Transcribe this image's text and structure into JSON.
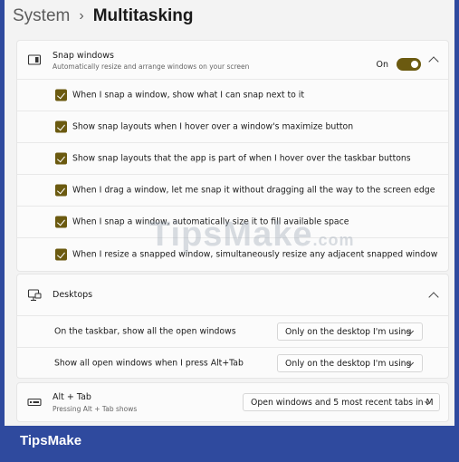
{
  "header": {
    "parent": "System",
    "separator": "›",
    "title": "Multitasking"
  },
  "snap": {
    "title": "Snap windows",
    "subtitle": "Automatically resize and arrange windows on your screen",
    "toggle_label": "On",
    "options": [
      "When I snap a window, show what I can snap next to it",
      "Show snap layouts when I hover over a window's maximize button",
      "Show snap layouts that the app is part of when I hover over the taskbar buttons",
      "When I drag a window, let me snap it without dragging all the way to the screen edge",
      "When I snap a window, automatically size it to fill available space",
      "When I resize a snapped window, simultaneously resize any adjacent snapped window"
    ]
  },
  "desktops": {
    "title": "Desktops",
    "rows": [
      {
        "label": "On the taskbar, show all the open windows",
        "value": "Only on the desktop I'm using"
      },
      {
        "label": "Show all open windows when I press Alt+Tab",
        "value": "Only on the desktop I'm using"
      }
    ]
  },
  "alttab": {
    "title": "Alt + Tab",
    "subtitle": "Pressing Alt + Tab shows",
    "value": "Open windows and 5 most recent tabs in M"
  },
  "watermark": {
    "main": "TipsMake",
    "suffix": ".com"
  },
  "brand": "TipsMake",
  "colors": {
    "accent": "#6b5a10",
    "page_bg": "#2f4a9e"
  }
}
